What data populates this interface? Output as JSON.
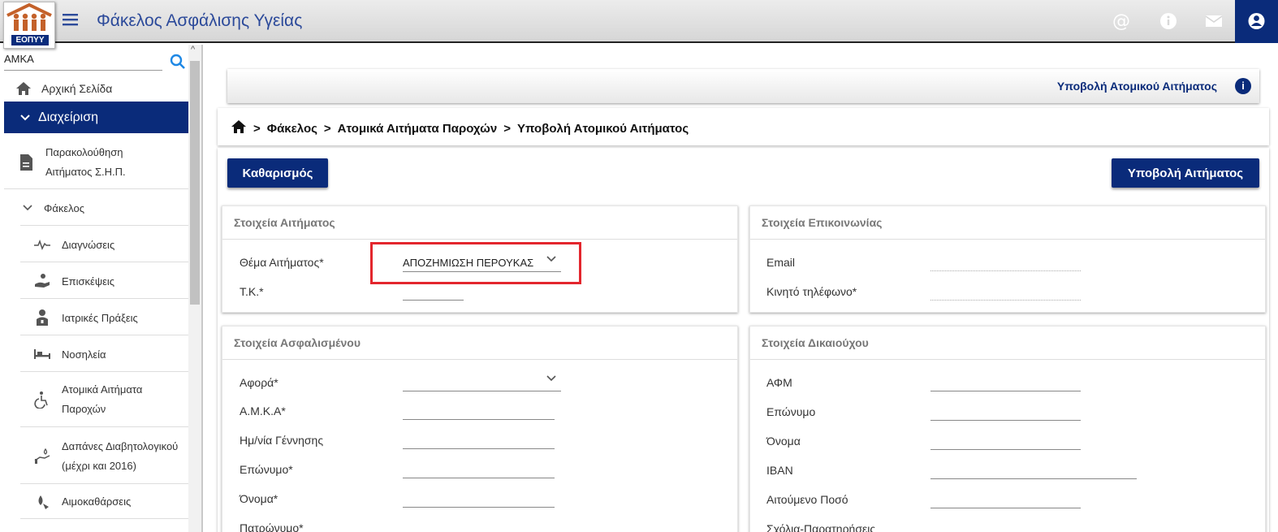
{
  "header": {
    "logo_text": "ΕΟΠΥΥ",
    "app_title": "Φάκελος Ασφάλισης Υγείας",
    "icons": [
      "at-icon",
      "info-icon",
      "mail-icon",
      "account-icon"
    ]
  },
  "sidebar": {
    "search_label": "ΑΜΚΑ",
    "items": [
      {
        "label": "Αρχική Σελίδα",
        "icon": "home-icon"
      },
      {
        "label": "Διαχείριση",
        "icon": "chevron-down-icon"
      },
      {
        "label_line1": "Παρακολούθηση",
        "label_line2": "Αιτήματος Σ.Η.Π.",
        "icon": "document-icon"
      },
      {
        "label": "Φάκελος",
        "icon": "chevron-down-icon"
      },
      {
        "label": "Διαγνώσεις",
        "icon": "pulse-icon"
      },
      {
        "label": "Επισκέψεις",
        "icon": "hand-care-icon"
      },
      {
        "label": "Ιατρικές Πράξεις",
        "icon": "doctor-icon"
      },
      {
        "label": "Νοσηλεία",
        "icon": "bed-icon"
      },
      {
        "label_line1": "Ατομικά Αιτήματα",
        "label_line2": "Παροχών",
        "icon": "wheelchair-icon"
      },
      {
        "label_line1": "Δαπάνες Διαβητολογικού",
        "label_line2": "(μέχρι και 2016)",
        "icon": "hand-drop-icon"
      },
      {
        "label": "Αιμοκαθάρσεις",
        "icon": "blood-drop-icon"
      }
    ]
  },
  "main": {
    "header_title": "Υποβολή Ατομικού Αιτήματος",
    "info_badge": "i",
    "breadcrumb": [
      "Φάκελος",
      "Ατομικά Αιτήματα Παροχών",
      "Υποβολή Ατομικού Αιτήματος"
    ],
    "buttons": {
      "clear": "Καθαρισμός",
      "submit": "Υποβολή Αιτήματος"
    },
    "request_section": {
      "title": "Στοιχεία Αιτήματος",
      "subject_label": "Θέμα Αιτήματος*",
      "subject_value": "ΑΠΟΖΗΜΙΩΣΗ ΠΕΡΟΥΚΑΣ",
      "postal_label": "Τ.Κ.*"
    },
    "contact_section": {
      "title": "Στοιχεία Επικοινωνίας",
      "email_label": "Email",
      "mobile_label": "Κινητό τηλέφωνο*"
    },
    "insured_section": {
      "title": "Στοιχεία Ασφαλισμένου",
      "fields": [
        "Αφορά*",
        "Α.Μ.Κ.Α*",
        "Ημ/νία Γέννησης",
        "Επώνυμο*",
        "Όνομα*",
        "Πατρώνυμο*"
      ]
    },
    "beneficiary_section": {
      "title": "Στοιχεία Δικαιούχου",
      "fields": [
        "ΑΦΜ",
        "Επώνυμο",
        "Όνομα",
        "IBAN",
        "Αιτούμενο Ποσό",
        "Σχόλια-Παρατηρήσεις"
      ]
    }
  },
  "colors": {
    "primary": "#0a2b7a",
    "title": "#2c4a9a",
    "highlight": "#e3262d"
  }
}
